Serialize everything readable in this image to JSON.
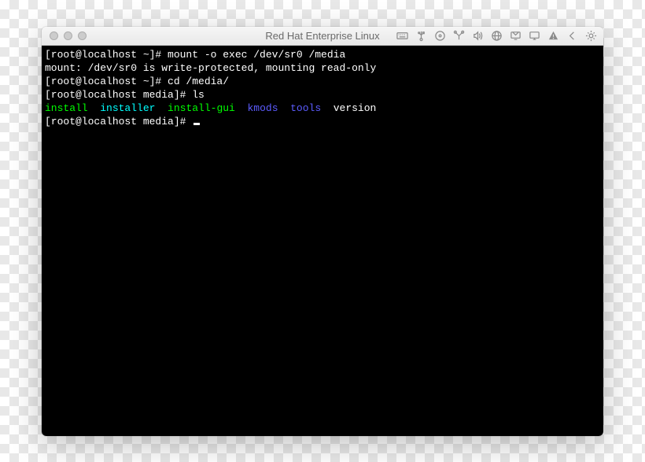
{
  "window": {
    "title": "Red Hat Enterprise Linux"
  },
  "toolbar_icons": [
    "keyboard-icon",
    "usb-icon",
    "disc-icon",
    "tools-icon",
    "sound-icon",
    "network-icon",
    "display-icon",
    "screen-icon",
    "warning-icon",
    "back-icon",
    "gear-icon"
  ],
  "terminal": {
    "lines": [
      {
        "segments": [
          {
            "text": "[root@localhost ~]# mount -o exec /dev/sr0 /media",
            "class": "white"
          }
        ]
      },
      {
        "segments": [
          {
            "text": "mount: /dev/sr0 is write-protected, mounting read-only",
            "class": "white"
          }
        ]
      },
      {
        "segments": [
          {
            "text": "[root@localhost ~]# cd /media/",
            "class": "white"
          }
        ]
      },
      {
        "segments": [
          {
            "text": "[root@localhost media]# ls",
            "class": "white"
          }
        ]
      },
      {
        "segments": [
          {
            "text": "install",
            "class": "green"
          },
          {
            "text": "  ",
            "class": "white"
          },
          {
            "text": "installer",
            "class": "cyan"
          },
          {
            "text": "  ",
            "class": "white"
          },
          {
            "text": "install-gui",
            "class": "green"
          },
          {
            "text": "  ",
            "class": "white"
          },
          {
            "text": "kmods",
            "class": "blue"
          },
          {
            "text": "  ",
            "class": "white"
          },
          {
            "text": "tools",
            "class": "blue"
          },
          {
            "text": "  version",
            "class": "white"
          }
        ]
      },
      {
        "segments": [
          {
            "text": "[root@localhost media]# ",
            "class": "white"
          }
        ],
        "cursor": true
      }
    ]
  }
}
